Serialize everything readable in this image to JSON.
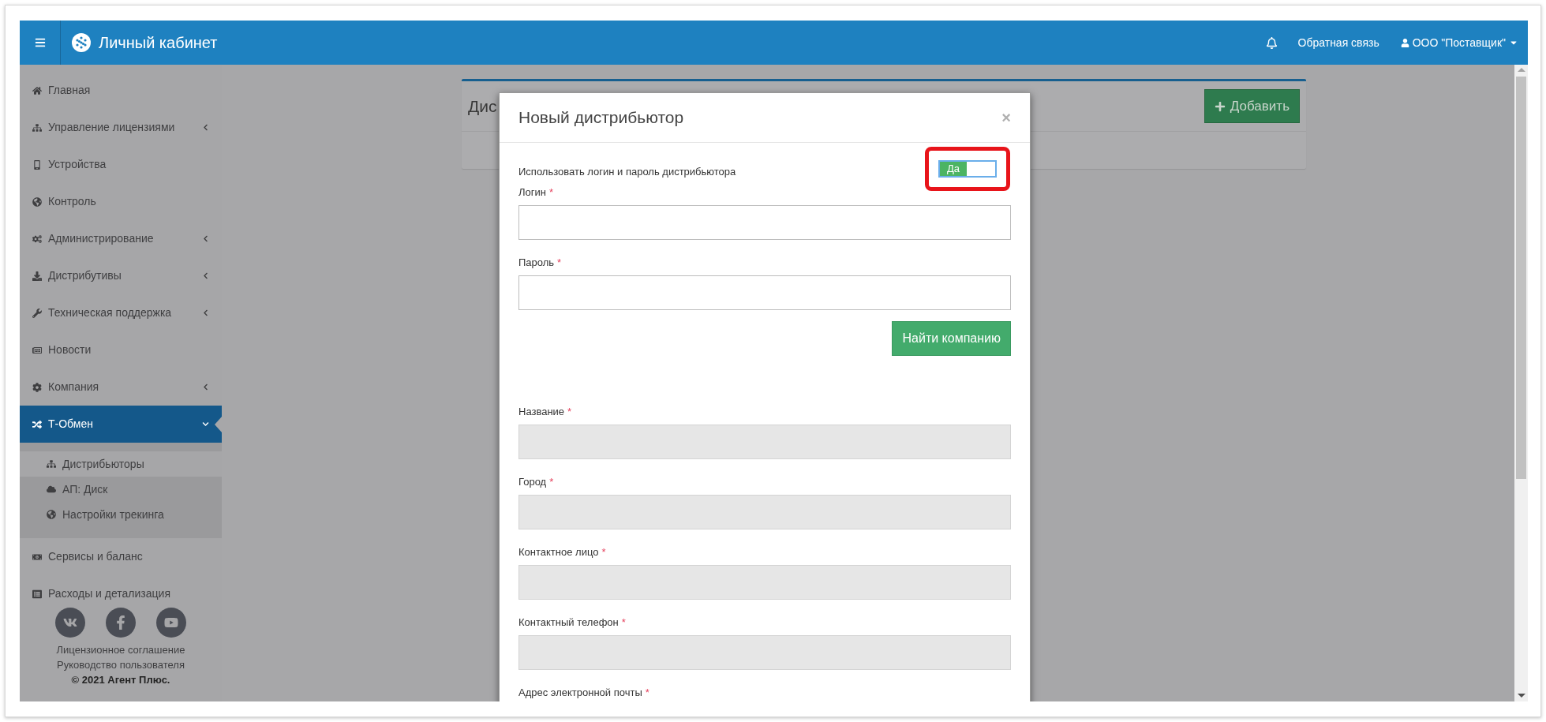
{
  "header": {
    "title": "Личный кабинет",
    "links": [
      "Обратная связь"
    ],
    "user": "ООО \"Поставщик\""
  },
  "sidebar": {
    "items": [
      {
        "label": "Главная",
        "kind": "link",
        "selected": false
      },
      {
        "label": "Управление лицензиями",
        "kind": "submenu",
        "expanded": false,
        "selected": false
      },
      {
        "label": "Устройства",
        "kind": "link",
        "selected": false
      },
      {
        "label": "Контроль",
        "kind": "link",
        "selected": false
      },
      {
        "label": "Администрирование",
        "kind": "submenu",
        "expanded": false,
        "selected": false
      },
      {
        "label": "Дистрибутивы",
        "kind": "submenu",
        "expanded": false,
        "selected": false
      },
      {
        "label": "Техническая поддержка",
        "kind": "submenu",
        "expanded": false,
        "selected": false
      },
      {
        "label": "Новости",
        "kind": "link",
        "selected": false
      },
      {
        "label": "Компания",
        "kind": "submenu",
        "expanded": false,
        "selected": false
      },
      {
        "label": "Т-Обмен",
        "kind": "submenu",
        "expanded": true,
        "selected": true,
        "children": [
          {
            "label": "Дистрибьюторы",
            "selected": true
          },
          {
            "label": "АП: Диск",
            "selected": false
          },
          {
            "label": "Настройки трекинга",
            "selected": false
          }
        ]
      },
      {
        "label": "Сервисы и баланс",
        "kind": "link",
        "selected": false
      },
      {
        "label": "Расходы и детализация",
        "kind": "link",
        "selected": false
      }
    ],
    "footer_links": [
      "Лицензионное соглашение",
      "Руководство пользователя"
    ],
    "copyright": "© 2021 Агент Плюс."
  },
  "card": {
    "title": "Дис",
    "add_button": "Добавить"
  },
  "modal": {
    "title": "Новый дистрибьютор",
    "close": "×",
    "toggle": {
      "label": "Использовать логин и пароль дистрибьютора",
      "on_text": "Да",
      "on": true,
      "highlighted": true
    },
    "fields": [
      {
        "label": "Логин",
        "required_mark": "*",
        "kind": "input",
        "disabled": false
      },
      {
        "label": "Пароль",
        "required_mark": "*",
        "kind": "input",
        "disabled": false
      },
      {
        "label": "Название",
        "required_mark": "*",
        "kind": "input",
        "disabled": true
      },
      {
        "label": "Город",
        "required_mark": "*",
        "kind": "input",
        "disabled": true
      },
      {
        "label": "Контактное лицо",
        "required_mark": "*",
        "kind": "input",
        "disabled": true
      },
      {
        "label": "Контактный телефон",
        "required_mark": "*",
        "kind": "input",
        "disabled": true
      },
      {
        "label": "Адрес электронной почты",
        "required_mark": "*",
        "kind": "label"
      }
    ],
    "search_button": "Найти компанию"
  }
}
